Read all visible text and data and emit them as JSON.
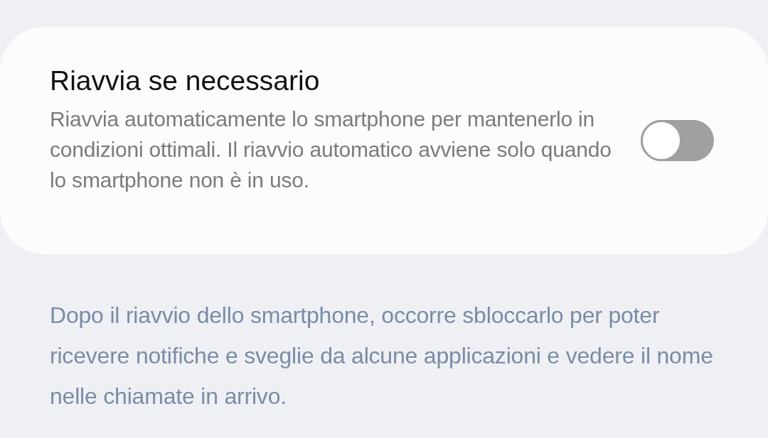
{
  "setting": {
    "title": "Riavvia se necessario",
    "description": "Riavvia automaticamente lo smartphone per mantenerlo in condizioni ottimali. Il riavvio automatico avviene solo quando lo smartphone non è in uso.",
    "on": false
  },
  "note": "Dopo il riavvio dello smartphone, occorre sbloccarlo per poter ricevere notifiche e sveglie da alcune applicazioni e vedere il nome nelle chiamate in arrivo."
}
